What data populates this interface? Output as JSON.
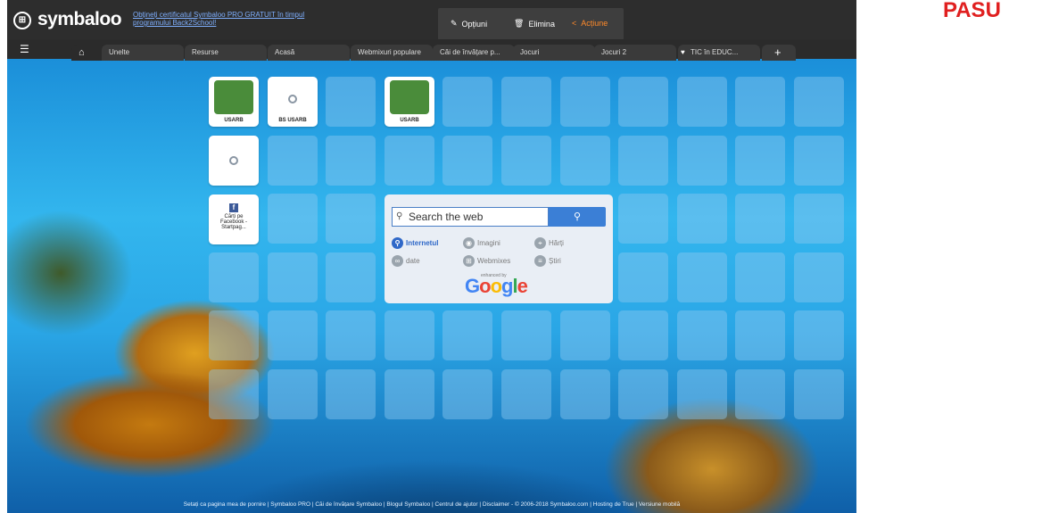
{
  "app": {
    "logo_glyph": "⊞",
    "name": "symbaloo"
  },
  "promo": "Obțineți certificatul Symbaloo PRO GRATUIT în timpul programului Back2School!",
  "actions": {
    "options": "Opțiuni",
    "delete": "Elimina",
    "action": "Acțiune"
  },
  "tabs": [
    "Unelte",
    "Resurse",
    "Acasă",
    "Webmixuri populare",
    "Căi de învățare p...",
    "Jocuri",
    "Jocuri 2",
    "TIC în EDUC..."
  ],
  "tiles": [
    {
      "label": "USARB",
      "type": "logo"
    },
    {
      "label": "BS USARB",
      "type": "globe"
    },
    {
      "label": "USARB",
      "type": "logo"
    },
    {
      "label": "",
      "type": "globe"
    },
    {
      "label": "Cărți pe Facebook - Startpag...",
      "type": "facebook"
    }
  ],
  "search": {
    "placeholder": "Search the web",
    "options": [
      {
        "label": "Internetul",
        "selected": true,
        "icon": "search-icon"
      },
      {
        "label": "Imagini",
        "selected": false,
        "icon": "camera-icon"
      },
      {
        "label": "Hărți",
        "selected": false,
        "icon": "map-pin-icon"
      },
      {
        "label": "date",
        "selected": false,
        "icon": "link-icon"
      },
      {
        "label": "Webmixes",
        "selected": false,
        "icon": "grid-icon"
      },
      {
        "label": "Știri",
        "selected": false,
        "icon": "news-icon"
      }
    ],
    "enhanced_by": "enhanced by",
    "google": "Google"
  },
  "footer": "Setați ca pagina mea de pornire  |  Symbaloo PRO  |  Căi de învățare Symbaloo  |  Blogul Symbaloo  |  Centrul de ajutor  |  Disclaimer - © 2006-2018 Symbaloo.com  |  Hosting de True  |  Versiune mobilă",
  "overlay_text": "PASU"
}
